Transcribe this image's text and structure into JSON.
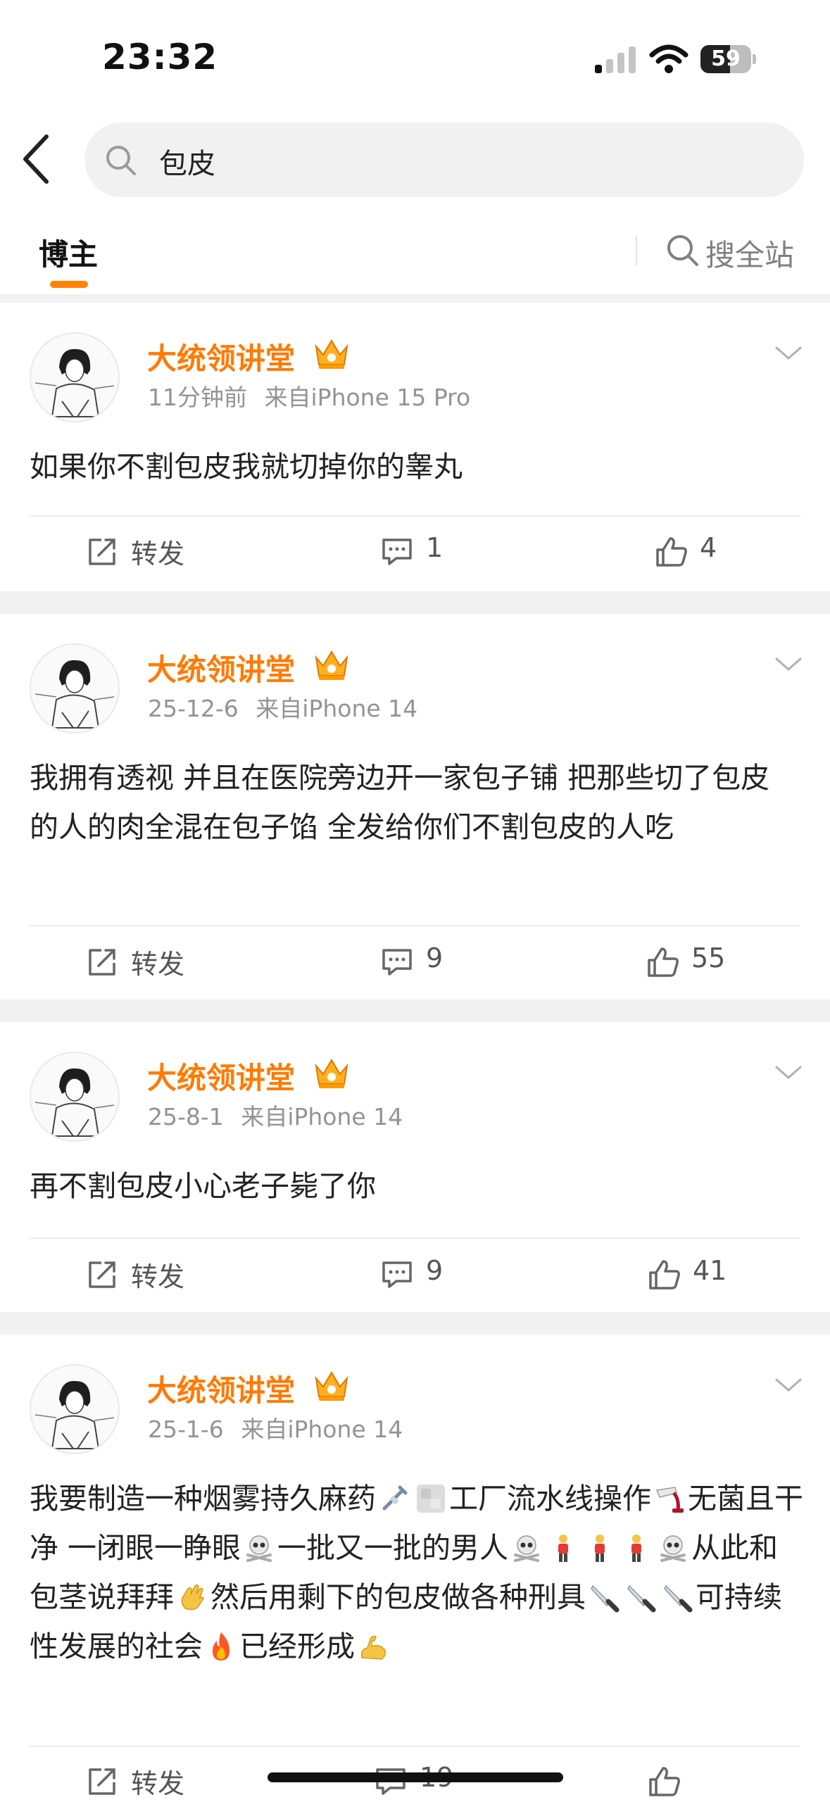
{
  "status_bar": {
    "time": "23:32",
    "battery": "59",
    "battery_level": 0.59,
    "signal_icon": "signal-bars-icon",
    "wifi_icon": "wifi-icon"
  },
  "search": {
    "query": "包皮",
    "search_icon": "search-icon",
    "back_icon": "back-arrow-icon"
  },
  "tabs": {
    "active": "博主",
    "search_all": "搜全站"
  },
  "colors": {
    "accent": "#ff8200",
    "username": "#ff7a00",
    "meta": "#939393",
    "gap": "#f1f1f1"
  },
  "actions": {
    "repost_label": "转发"
  },
  "posts": [
    {
      "username": "大统领讲堂",
      "time": "11分钟前",
      "source": "来自iPhone 15 Pro",
      "text": "如果你不割包皮我就切掉你的睾丸",
      "comments": "1",
      "likes": "4"
    },
    {
      "username": "大统领讲堂",
      "time": "25-12-6",
      "source": "来自iPhone 14",
      "text": "我拥有透视 并且在医院旁边开一家包子铺 把那些切了包皮的人的肉全混在包子馅 全发给你们不割包皮的人吃",
      "comments": "9",
      "likes": "55"
    },
    {
      "username": "大统领讲堂",
      "time": "25-8-1",
      "source": "来自iPhone 14",
      "text": "再不割包皮小心老子毙了你",
      "comments": "9",
      "likes": "41"
    },
    {
      "username": "大统领讲堂",
      "time": "25-1-6",
      "source": "来自iPhone 14",
      "text_parts": [
        "我要制造一种烟雾持久麻药",
        "工厂流水线操作",
        "无菌且干净 一闭眼一睁眼",
        "一批又一批的男人",
        "从此和包茎说拜拜",
        "然后用剩下的包皮做各种刑具",
        "可持续性发展的社会",
        "已经形成"
      ],
      "comments": "19"
    }
  ]
}
